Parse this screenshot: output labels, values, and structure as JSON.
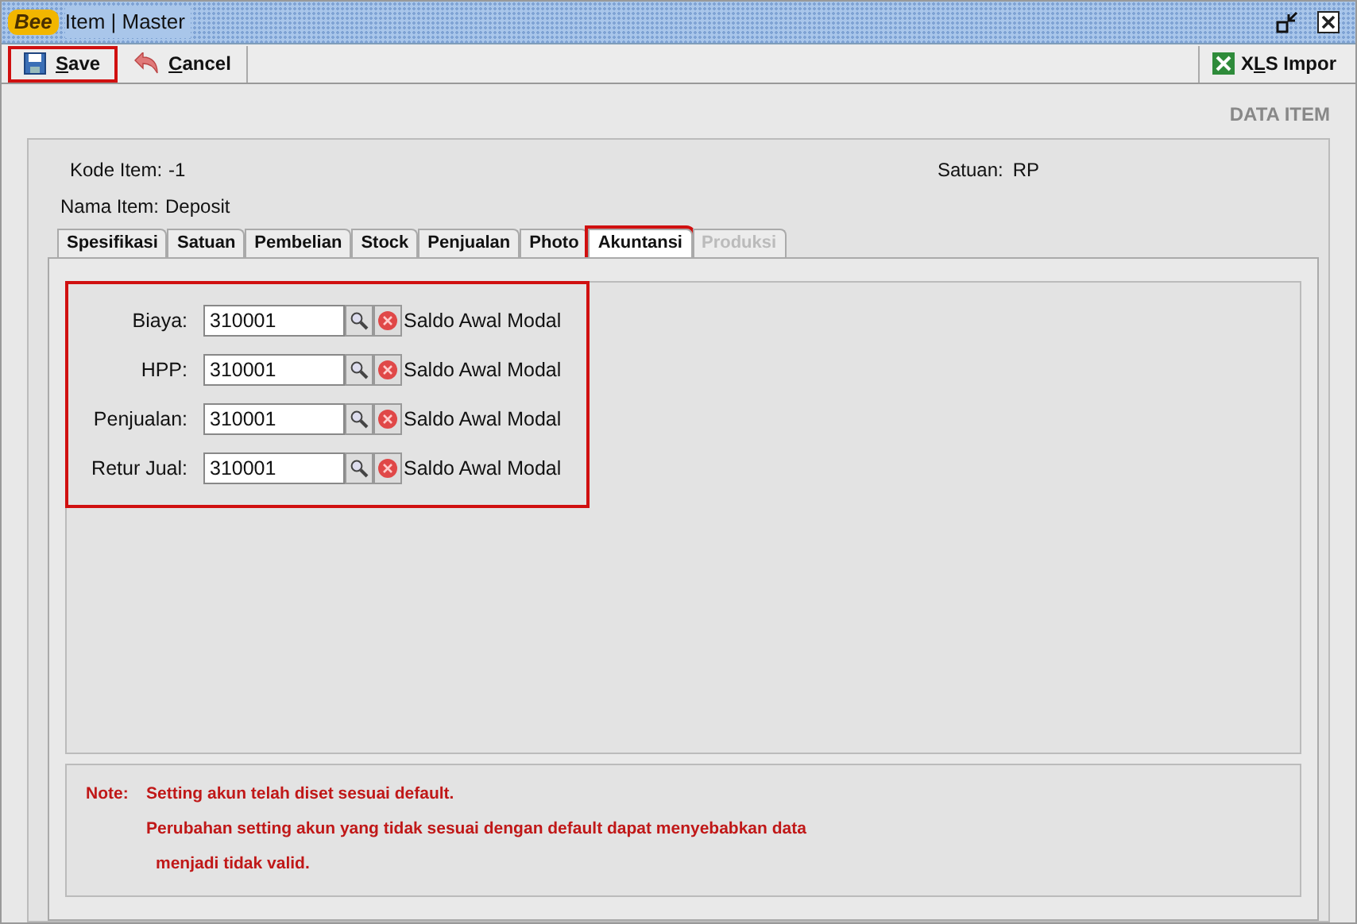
{
  "window": {
    "logo": "Bee",
    "title": "Item | Master"
  },
  "toolbar": {
    "buttons": [
      {
        "mnemonic": "S",
        "rest": "ave",
        "kind": "save",
        "highlighted": true
      },
      {
        "mnemonic": "C",
        "rest": "ancel",
        "kind": "cancel",
        "highlighted": false
      }
    ],
    "import_button": {
      "before": "X",
      "mnemonic": "L",
      "rest": "S Impor"
    }
  },
  "section_title": "DATA ITEM",
  "header": {
    "kode_label": "Kode Item:",
    "kode_value": "-1",
    "nama_label": "Nama Item:",
    "nama_value": "Deposit",
    "satuan_label": "Satuan:",
    "satuan_value": "RP"
  },
  "tabs": [
    {
      "label": "Spesifikasi",
      "selected": false,
      "disabled": false,
      "highlighted": false
    },
    {
      "label": "Satuan",
      "selected": false,
      "disabled": false,
      "highlighted": false
    },
    {
      "label": "Pembelian",
      "selected": false,
      "disabled": false,
      "highlighted": false
    },
    {
      "label": "Stock",
      "selected": false,
      "disabled": false,
      "highlighted": false
    },
    {
      "label": "Penjualan",
      "selected": false,
      "disabled": false,
      "highlighted": false
    },
    {
      "label": "Photo",
      "selected": false,
      "disabled": false,
      "highlighted": false
    },
    {
      "label": "Akuntansi",
      "selected": true,
      "disabled": false,
      "highlighted": true
    },
    {
      "label": "Produksi",
      "selected": false,
      "disabled": true,
      "highlighted": false
    }
  ],
  "accounts": {
    "highlighted": true,
    "rows": [
      {
        "label": "Biaya:",
        "value": "310001",
        "name": "Saldo Awal Modal"
      },
      {
        "label": "HPP:",
        "value": "310001",
        "name": "Saldo Awal Modal"
      },
      {
        "label": "Penjualan:",
        "value": "310001",
        "name": "Saldo Awal Modal"
      },
      {
        "label": "Retur Jual:",
        "value": "310001",
        "name": "Saldo Awal Modal"
      }
    ]
  },
  "note": {
    "label": "Note:",
    "lines": [
      "Setting akun telah diset sesuai default.",
      "Perubahan setting akun yang tidak sesuai dengan default dapat menyebabkan data",
      "menjadi tidak valid."
    ]
  }
}
